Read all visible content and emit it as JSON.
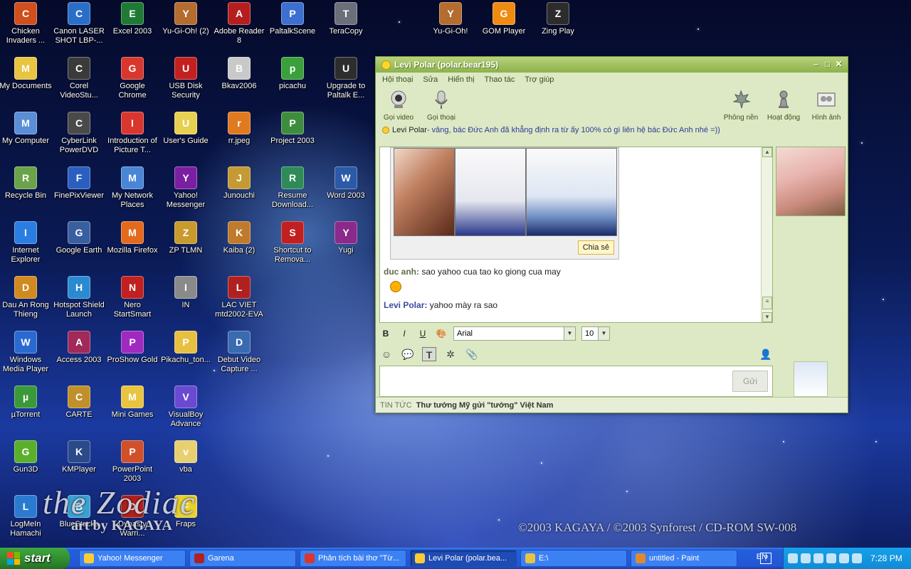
{
  "desktop": {
    "icons": [
      {
        "label": "Chicken Invaders ...",
        "color": "#d04f1c"
      },
      {
        "label": "Canon LASER SHOT LBP-...",
        "color": "#2a6ec7"
      },
      {
        "label": "Excel 2003",
        "color": "#1f7a35"
      },
      {
        "label": "Yu-Gi-Oh! (2)",
        "color": "#b46c2f"
      },
      {
        "label": "Adobe Reader 8",
        "color": "#b41e1e"
      },
      {
        "label": "PaltalkScene",
        "color": "#3c6fd0"
      },
      {
        "label": "TeraCopy",
        "color": "#6a6f7a"
      },
      {
        "label": "Yu-Gi-Oh!",
        "color": "#b46c2f"
      },
      {
        "label": "GOM Player",
        "color": "#ee8b10"
      },
      {
        "label": "Zing Play",
        "color": "#2c2c2c"
      },
      {
        "label": "My Documents",
        "color": "#e8c440"
      },
      {
        "label": "Corel VideoStu...",
        "color": "#3a3a3a"
      },
      {
        "label": "Google Chrome",
        "color": "#d9372e"
      },
      {
        "label": "USB Disk Security",
        "color": "#c52020"
      },
      {
        "label": "Bkav2006",
        "color": "#c9c9c9"
      },
      {
        "label": "picachu",
        "color": "#3aa03a"
      },
      {
        "label": "Upgrade to Paltalk E...",
        "color": "#2d2d2d"
      },
      {
        "label": "My Computer",
        "color": "#5a8ed6"
      },
      {
        "label": "CyberLink PowerDVD",
        "color": "#4a4a4a"
      },
      {
        "label": "Introduction of Picture T...",
        "color": "#d9372e"
      },
      {
        "label": "User's Guide",
        "color": "#e8d050"
      },
      {
        "label": "rr.jpeg",
        "color": "#e07a20"
      },
      {
        "label": "Project 2003",
        "color": "#3e8d3e"
      },
      {
        "label": "Recycle Bin",
        "color": "#6aa34a"
      },
      {
        "label": "FinePixViewer",
        "color": "#2a5fbf"
      },
      {
        "label": "My Network Places",
        "color": "#4a86d6"
      },
      {
        "label": "Yahoo! Messenger",
        "color": "#7b1fa2"
      },
      {
        "label": "Junouchi",
        "color": "#c59a35"
      },
      {
        "label": "Resume Download...",
        "color": "#2e8b57"
      },
      {
        "label": "Word 2003",
        "color": "#2a5aa8"
      },
      {
        "label": "Internet Explorer",
        "color": "#2a7de1"
      },
      {
        "label": "Google Earth",
        "color": "#3a5fa0"
      },
      {
        "label": "Mozilla Firefox",
        "color": "#e36a1c"
      },
      {
        "label": "ZP TLMN",
        "color": "#c99a2c"
      },
      {
        "label": "Kaiba (2)",
        "color": "#c07a2c"
      },
      {
        "label": "Shortcut to Remova...",
        "color": "#c02020"
      },
      {
        "label": "Yugi",
        "color": "#8a2a8a"
      },
      {
        "label": "Dau An Rong Thieng",
        "color": "#d08a20"
      },
      {
        "label": "Hotspot Shield Launch",
        "color": "#2a8ad0"
      },
      {
        "label": "Nero StartSmart",
        "color": "#c02020"
      },
      {
        "label": "IN",
        "color": "#8a8a8a"
      },
      {
        "label": "LAC VIET mtd2002-EVA",
        "color": "#b02020"
      },
      {
        "label": "Windows Media Player",
        "color": "#2a6ad0"
      },
      {
        "label": "Access 2003",
        "color": "#a02a5a"
      },
      {
        "label": "ProShow Gold",
        "color": "#a02ac0"
      },
      {
        "label": "Pikachu_ton...",
        "color": "#e8c040"
      },
      {
        "label": "Debut Video Capture ...",
        "color": "#3a6ab0"
      },
      {
        "label": "µTorrent",
        "color": "#3a9a3a"
      },
      {
        "label": "CARTE",
        "color": "#c0902a"
      },
      {
        "label": "Mini Games",
        "color": "#e8c440"
      },
      {
        "label": "VisualBoy Advance",
        "color": "#6a4ad0"
      },
      {
        "label": "Gun3D",
        "color": "#5ab02a"
      },
      {
        "label": "KMPlayer",
        "color": "#2a4a8a"
      },
      {
        "label": "PowerPoint 2003",
        "color": "#d0502a"
      },
      {
        "label": "vba",
        "color": "#e8d070"
      },
      {
        "label": "LogMeIn Hamachi",
        "color": "#2a7ad0"
      },
      {
        "label": "BlueStacks",
        "color": "#3aa0d0"
      },
      {
        "label": "Dynasty Warri...",
        "color": "#b0201a"
      },
      {
        "label": "Fraps",
        "color": "#e8d030"
      }
    ],
    "wallpaper_title": "the Zodiac",
    "wallpaper_credit": "art by KAGAYA",
    "wallpaper_copyright": "©2003 KAGAYA / ©2003 Synforest / CD-ROM SW-008"
  },
  "messenger": {
    "title": "Levi Polar (polar.bear195)",
    "menu": [
      "Hội thoại",
      "Sửa",
      "Hiển thị",
      "Thao tác",
      "Trợ giúp"
    ],
    "toolbar_left": [
      {
        "label": "Gọi video",
        "icon": "webcam-icon"
      },
      {
        "label": "Gọi thoại",
        "icon": "microphone-icon"
      }
    ],
    "toolbar_right": [
      {
        "label": "Phông nền",
        "icon": "maple-leaf-icon"
      },
      {
        "label": "Hoạt động",
        "icon": "chess-pawn-icon"
      },
      {
        "label": "Hình ảnh",
        "icon": "photo-icon"
      }
    ],
    "status_name": "Levi Polar",
    "status_message": " - vâng, bác Đức Anh đã khẳng định ra từ ấy 100% có gì liên hệ bác Đức Anh nhé =))",
    "share_button": "Chia sẻ",
    "messages": [
      {
        "sender": "duc anh:",
        "text": " sao yahoo cua tao ko giong cua may"
      },
      {
        "sender": "Levi Polar:",
        "text": " yahoo mày ra sao"
      }
    ],
    "font_name": "Arial",
    "font_size": "10",
    "format_buttons": [
      "B",
      "I",
      "U"
    ],
    "send_button": "Gửi",
    "news_label": "TIN TỨC",
    "news_headline": "Thư tướng Mỹ gửi \"tướng\" Việt Nam"
  },
  "taskbar": {
    "start_label": "start",
    "tasks": [
      {
        "label": "Yahoo! Messenger",
        "color": "#ffcc33",
        "active": false
      },
      {
        "label": "Garena",
        "color": "#b02020",
        "active": false
      },
      {
        "label": "Phân tích bài thơ \"Từ...",
        "color": "#d9372e",
        "active": false
      },
      {
        "label": "Levi Polar (polar.bea...",
        "color": "#ffcc33",
        "active": true
      },
      {
        "label": "E:\\",
        "color": "#e8c440",
        "active": false
      },
      {
        "label": "untitled - Paint",
        "color": "#e08a30",
        "active": false
      }
    ],
    "language": "EN",
    "help": "?",
    "clock": "7:28 PM"
  }
}
